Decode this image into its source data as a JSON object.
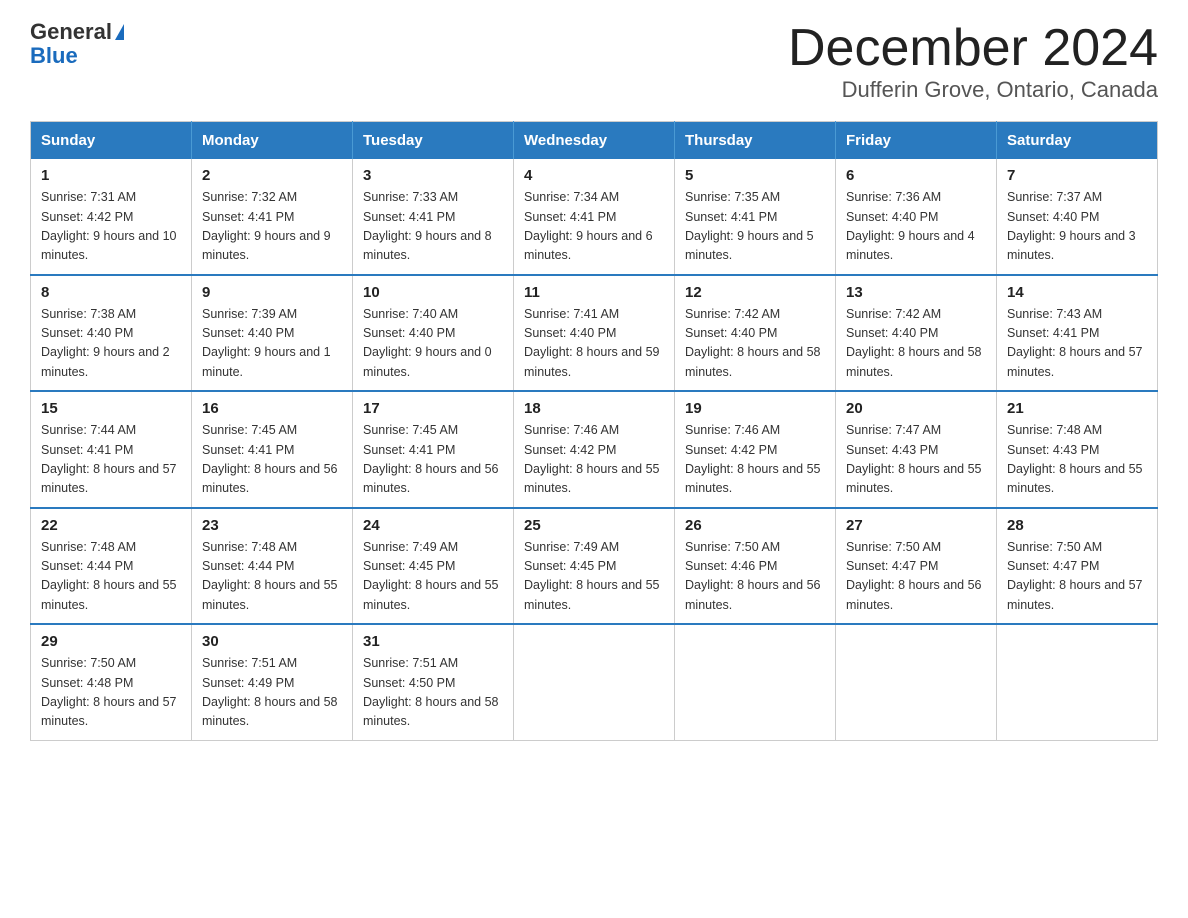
{
  "logo": {
    "line1": "General",
    "triangle": "▶",
    "line2": "Blue"
  },
  "header": {
    "month": "December 2024",
    "location": "Dufferin Grove, Ontario, Canada"
  },
  "days_of_week": [
    "Sunday",
    "Monday",
    "Tuesday",
    "Wednesday",
    "Thursday",
    "Friday",
    "Saturday"
  ],
  "weeks": [
    [
      {
        "day": "1",
        "sunrise": "7:31 AM",
        "sunset": "4:42 PM",
        "daylight": "9 hours and 10 minutes."
      },
      {
        "day": "2",
        "sunrise": "7:32 AM",
        "sunset": "4:41 PM",
        "daylight": "9 hours and 9 minutes."
      },
      {
        "day": "3",
        "sunrise": "7:33 AM",
        "sunset": "4:41 PM",
        "daylight": "9 hours and 8 minutes."
      },
      {
        "day": "4",
        "sunrise": "7:34 AM",
        "sunset": "4:41 PM",
        "daylight": "9 hours and 6 minutes."
      },
      {
        "day": "5",
        "sunrise": "7:35 AM",
        "sunset": "4:41 PM",
        "daylight": "9 hours and 5 minutes."
      },
      {
        "day": "6",
        "sunrise": "7:36 AM",
        "sunset": "4:40 PM",
        "daylight": "9 hours and 4 minutes."
      },
      {
        "day": "7",
        "sunrise": "7:37 AM",
        "sunset": "4:40 PM",
        "daylight": "9 hours and 3 minutes."
      }
    ],
    [
      {
        "day": "8",
        "sunrise": "7:38 AM",
        "sunset": "4:40 PM",
        "daylight": "9 hours and 2 minutes."
      },
      {
        "day": "9",
        "sunrise": "7:39 AM",
        "sunset": "4:40 PM",
        "daylight": "9 hours and 1 minute."
      },
      {
        "day": "10",
        "sunrise": "7:40 AM",
        "sunset": "4:40 PM",
        "daylight": "9 hours and 0 minutes."
      },
      {
        "day": "11",
        "sunrise": "7:41 AM",
        "sunset": "4:40 PM",
        "daylight": "8 hours and 59 minutes."
      },
      {
        "day": "12",
        "sunrise": "7:42 AM",
        "sunset": "4:40 PM",
        "daylight": "8 hours and 58 minutes."
      },
      {
        "day": "13",
        "sunrise": "7:42 AM",
        "sunset": "4:40 PM",
        "daylight": "8 hours and 58 minutes."
      },
      {
        "day": "14",
        "sunrise": "7:43 AM",
        "sunset": "4:41 PM",
        "daylight": "8 hours and 57 minutes."
      }
    ],
    [
      {
        "day": "15",
        "sunrise": "7:44 AM",
        "sunset": "4:41 PM",
        "daylight": "8 hours and 57 minutes."
      },
      {
        "day": "16",
        "sunrise": "7:45 AM",
        "sunset": "4:41 PM",
        "daylight": "8 hours and 56 minutes."
      },
      {
        "day": "17",
        "sunrise": "7:45 AM",
        "sunset": "4:41 PM",
        "daylight": "8 hours and 56 minutes."
      },
      {
        "day": "18",
        "sunrise": "7:46 AM",
        "sunset": "4:42 PM",
        "daylight": "8 hours and 55 minutes."
      },
      {
        "day": "19",
        "sunrise": "7:46 AM",
        "sunset": "4:42 PM",
        "daylight": "8 hours and 55 minutes."
      },
      {
        "day": "20",
        "sunrise": "7:47 AM",
        "sunset": "4:43 PM",
        "daylight": "8 hours and 55 minutes."
      },
      {
        "day": "21",
        "sunrise": "7:48 AM",
        "sunset": "4:43 PM",
        "daylight": "8 hours and 55 minutes."
      }
    ],
    [
      {
        "day": "22",
        "sunrise": "7:48 AM",
        "sunset": "4:44 PM",
        "daylight": "8 hours and 55 minutes."
      },
      {
        "day": "23",
        "sunrise": "7:48 AM",
        "sunset": "4:44 PM",
        "daylight": "8 hours and 55 minutes."
      },
      {
        "day": "24",
        "sunrise": "7:49 AM",
        "sunset": "4:45 PM",
        "daylight": "8 hours and 55 minutes."
      },
      {
        "day": "25",
        "sunrise": "7:49 AM",
        "sunset": "4:45 PM",
        "daylight": "8 hours and 55 minutes."
      },
      {
        "day": "26",
        "sunrise": "7:50 AM",
        "sunset": "4:46 PM",
        "daylight": "8 hours and 56 minutes."
      },
      {
        "day": "27",
        "sunrise": "7:50 AM",
        "sunset": "4:47 PM",
        "daylight": "8 hours and 56 minutes."
      },
      {
        "day": "28",
        "sunrise": "7:50 AM",
        "sunset": "4:47 PM",
        "daylight": "8 hours and 57 minutes."
      }
    ],
    [
      {
        "day": "29",
        "sunrise": "7:50 AM",
        "sunset": "4:48 PM",
        "daylight": "8 hours and 57 minutes."
      },
      {
        "day": "30",
        "sunrise": "7:51 AM",
        "sunset": "4:49 PM",
        "daylight": "8 hours and 58 minutes."
      },
      {
        "day": "31",
        "sunrise": "7:51 AM",
        "sunset": "4:50 PM",
        "daylight": "8 hours and 58 minutes."
      },
      null,
      null,
      null,
      null
    ]
  ]
}
